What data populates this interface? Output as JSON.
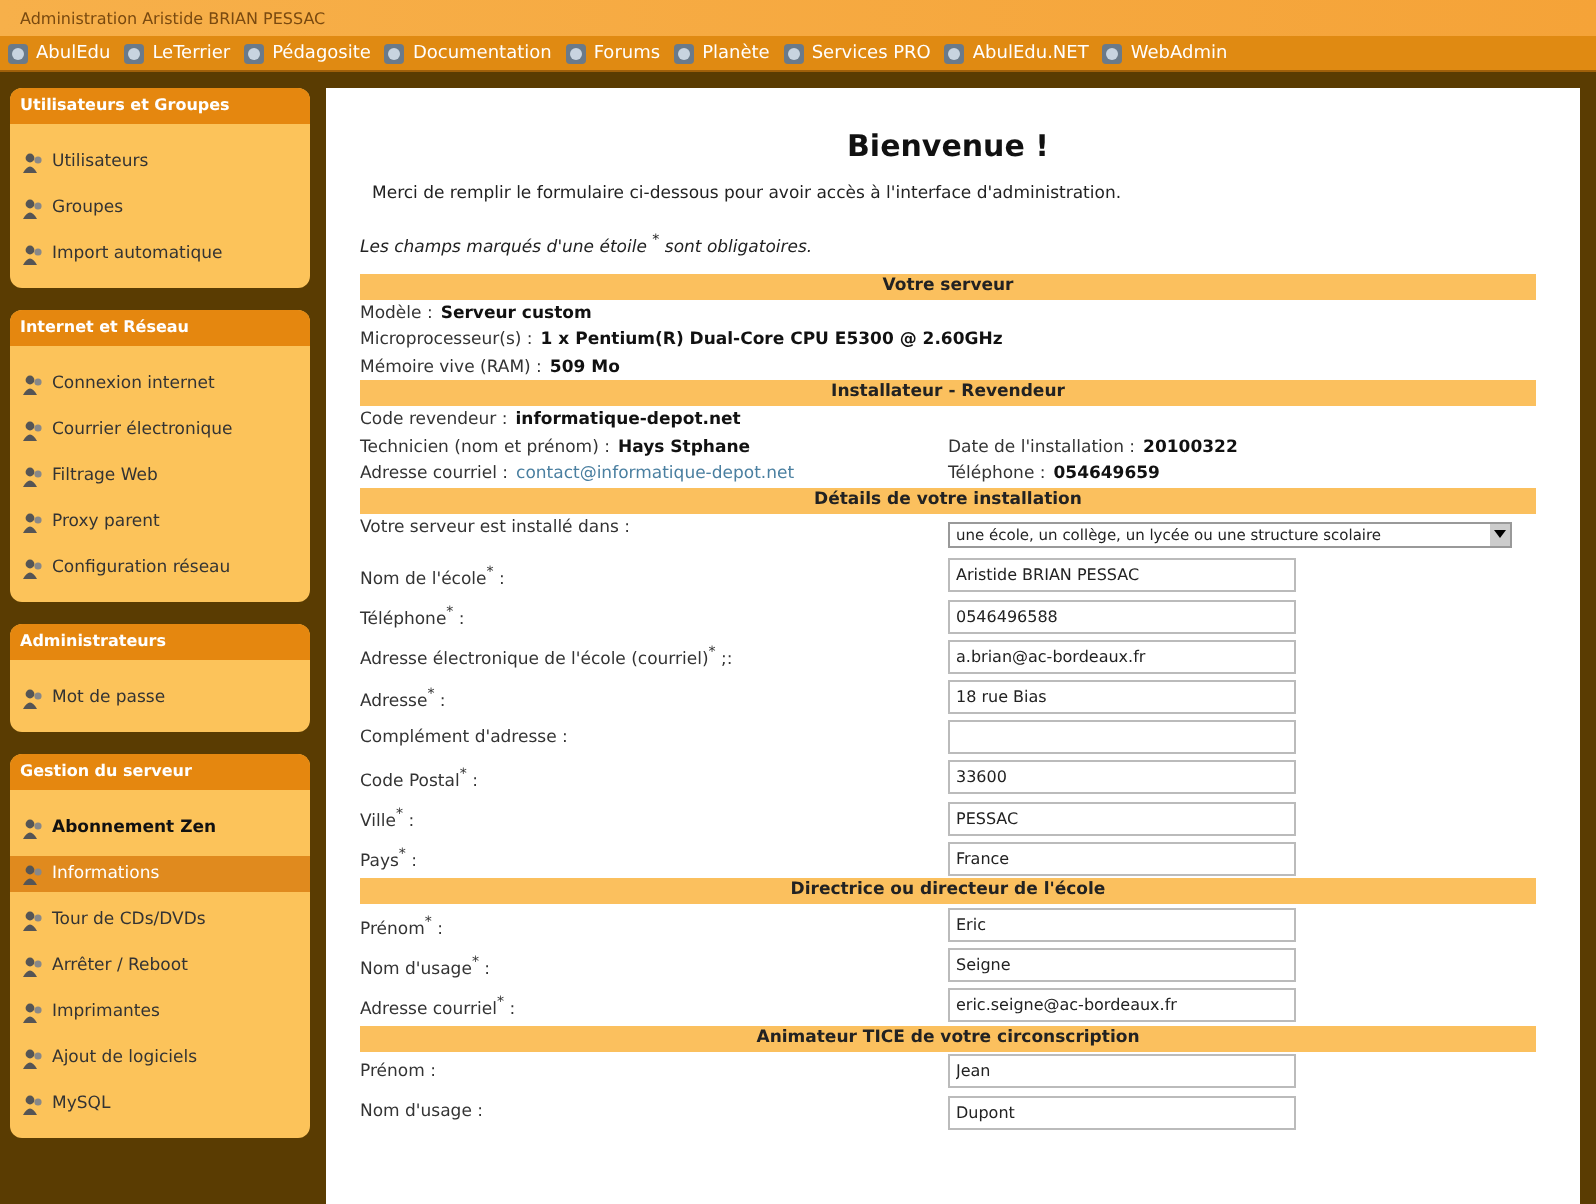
{
  "header": {
    "title": "Administration Aristide BRIAN PESSAC"
  },
  "nav": [
    {
      "label": "AbulEdu"
    },
    {
      "label": "LeTerrier"
    },
    {
      "label": "Pédagosite"
    },
    {
      "label": "Documentation"
    },
    {
      "label": "Forums"
    },
    {
      "label": "Planète"
    },
    {
      "label": "Services PRO"
    },
    {
      "label": "AbulEdu.NET"
    },
    {
      "label": "WebAdmin"
    }
  ],
  "sidebar": {
    "groups": [
      {
        "title": "Utilisateurs et Groupes",
        "items": [
          {
            "label": "Utilisateurs",
            "selected": false,
            "bold": false
          },
          {
            "label": "Groupes",
            "selected": false,
            "bold": false
          },
          {
            "label": "Import automatique",
            "selected": false,
            "bold": false
          }
        ]
      },
      {
        "title": "Internet et Réseau",
        "items": [
          {
            "label": "Connexion internet",
            "selected": false,
            "bold": false
          },
          {
            "label": "Courrier électronique",
            "selected": false,
            "bold": false
          },
          {
            "label": "Filtrage Web",
            "selected": false,
            "bold": false
          },
          {
            "label": "Proxy parent",
            "selected": false,
            "bold": false
          },
          {
            "label": "Configuration réseau",
            "selected": false,
            "bold": false
          }
        ]
      },
      {
        "title": "Administrateurs",
        "items": [
          {
            "label": "Mot de passe",
            "selected": false,
            "bold": false
          }
        ]
      },
      {
        "title": "Gestion du serveur",
        "items": [
          {
            "label": "Abonnement Zen",
            "selected": false,
            "bold": true
          },
          {
            "label": "Informations",
            "selected": true,
            "bold": false
          },
          {
            "label": "Tour de CDs/DVDs",
            "selected": false,
            "bold": false
          },
          {
            "label": "Arrêter / Reboot",
            "selected": false,
            "bold": false
          },
          {
            "label": "Imprimantes",
            "selected": false,
            "bold": false
          },
          {
            "label": "Ajout de logiciels",
            "selected": false,
            "bold": false
          },
          {
            "label": "MySQL",
            "selected": false,
            "bold": false
          }
        ]
      }
    ]
  },
  "main": {
    "title": "Bienvenue !",
    "intro": "Merci de remplir le formulaire ci-dessous pour avoir accès à l'interface d'administration.",
    "note": "Les champs marqués d'une étoile $^{*}$ sont obligatoires.",
    "sections": [
      {
        "title": "Votre serveur",
        "rows": [
          {
            "kind": "info",
            "cells": [
              {
                "label": "Modèle :",
                "value": "Serveur custom",
                "kind": "text"
              }
            ]
          },
          {
            "kind": "info",
            "cells": [
              {
                "label": "Microprocesseur(s) :",
                "value": "1 x Pentium(R) Dual-Core CPU E5300 @ 2.60GHz",
                "kind": "text"
              }
            ]
          },
          {
            "kind": "info",
            "cells": [
              {
                "label": "Mémoire vive (RAM) :",
                "value": "509 Mo",
                "kind": "text"
              }
            ]
          }
        ]
      },
      {
        "title": "Installateur - Revendeur",
        "rows": [
          {
            "kind": "info",
            "cells": [
              {
                "label": "Code revendeur :",
                "value": "informatique-depot.net",
                "kind": "text"
              }
            ]
          },
          {
            "kind": "info",
            "cells": [
              {
                "label": "Technicien (nom et prénom) :",
                "value": "Hays Stphane",
                "kind": "text"
              },
              {
                "label": "Date de l'installation :",
                "value": "20100322",
                "kind": "text"
              }
            ]
          },
          {
            "kind": "info",
            "cells": [
              {
                "label": "Adresse courriel :",
                "value": "contact@informatique-depot.net",
                "kind": "link"
              },
              {
                "label": "Téléphone :",
                "value": "054649659",
                "kind": "text"
              }
            ]
          }
        ]
      },
      {
        "title": "Détails de votre installation",
        "rows": [
          {
            "kind": "select",
            "label": "Votre serveur est installé dans :",
            "value": "une école, un collège, un lycée ou une structure scolaire"
          },
          {
            "kind": "input",
            "label": "Nom de l'école$^{*}$ :",
            "value": "Aristide BRIAN PESSAC"
          },
          {
            "kind": "input",
            "label": "Téléphone$^{*}$ :",
            "value": "0546496588"
          },
          {
            "kind": "input",
            "label": "Adresse électronique de l'école (courriel)$^{*}$ ;:",
            "value": "a.brian@ac-bordeaux.fr"
          },
          {
            "kind": "input",
            "label": "Adresse$^{*}$ :",
            "value": "18 rue Bias"
          },
          {
            "kind": "input",
            "label": "Complément d'adresse :"
          },
          {
            "kind": "input",
            "label": "Code Postal$^{*}$ :",
            "value": "33600"
          },
          {
            "kind": "input",
            "label": "Ville$^{*}$ :",
            "value": "PESSAC"
          },
          {
            "kind": "input",
            "label": "Pays$^{*}$ :",
            "value": "France"
          }
        ]
      },
      {
        "title": "Directrice ou directeur de l'école",
        "rows": [
          {
            "kind": "input",
            "label": "Prénom$^{*}$ :",
            "value": "Eric"
          },
          {
            "kind": "input",
            "label": "Nom d'usage$^{*}$ :",
            "value": "Seigne"
          },
          {
            "kind": "input",
            "label": "Adresse courriel$^{*}$ :",
            "value": "eric.seigne@ac-bordeaux.fr"
          }
        ]
      },
      {
        "title": "Animateur TICE de votre circonscription",
        "rows": [
          {
            "kind": "input",
            "label": "Prénom :",
            "value": "Jean"
          },
          {
            "kind": "input",
            "label": "Nom d'usage :",
            "value": "Dupont"
          }
        ]
      }
    ]
  }
}
